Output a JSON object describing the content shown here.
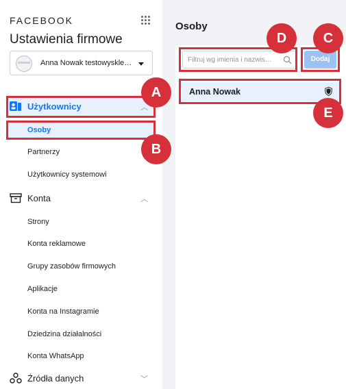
{
  "sidebar": {
    "brand": "FACEBOOK",
    "title": "Ustawienia firmowe",
    "account_name": "Anna Nowak testowyskle…",
    "sections": {
      "users": {
        "label": "Użytkownicy",
        "items": [
          "Osoby",
          "Partnerzy",
          "Użytkownicy systemowi"
        ]
      },
      "konta": {
        "label": "Konta",
        "items": [
          "Strony",
          "Konta reklamowe",
          "Grupy zasobów firmowych",
          "Aplikacje",
          "Konta na Instagramie",
          "Dziedzina działalności",
          "Konta WhatsApp"
        ]
      },
      "zrodla": {
        "label": "Źródła danych"
      }
    }
  },
  "main": {
    "page_title": "Osoby",
    "search_placeholder": "Filtruj wg imienia i nazwis…",
    "add_label": "Dodaj",
    "people": [
      "Anna Nowak"
    ]
  },
  "annotations": {
    "a": "A",
    "b": "B",
    "c": "C",
    "d": "D",
    "e": "E"
  },
  "colors": {
    "accent": "#1877f2",
    "selected_bg": "#e7f0fd",
    "annotation_red": "#d6303b",
    "add_button": "#9cc1f5"
  }
}
